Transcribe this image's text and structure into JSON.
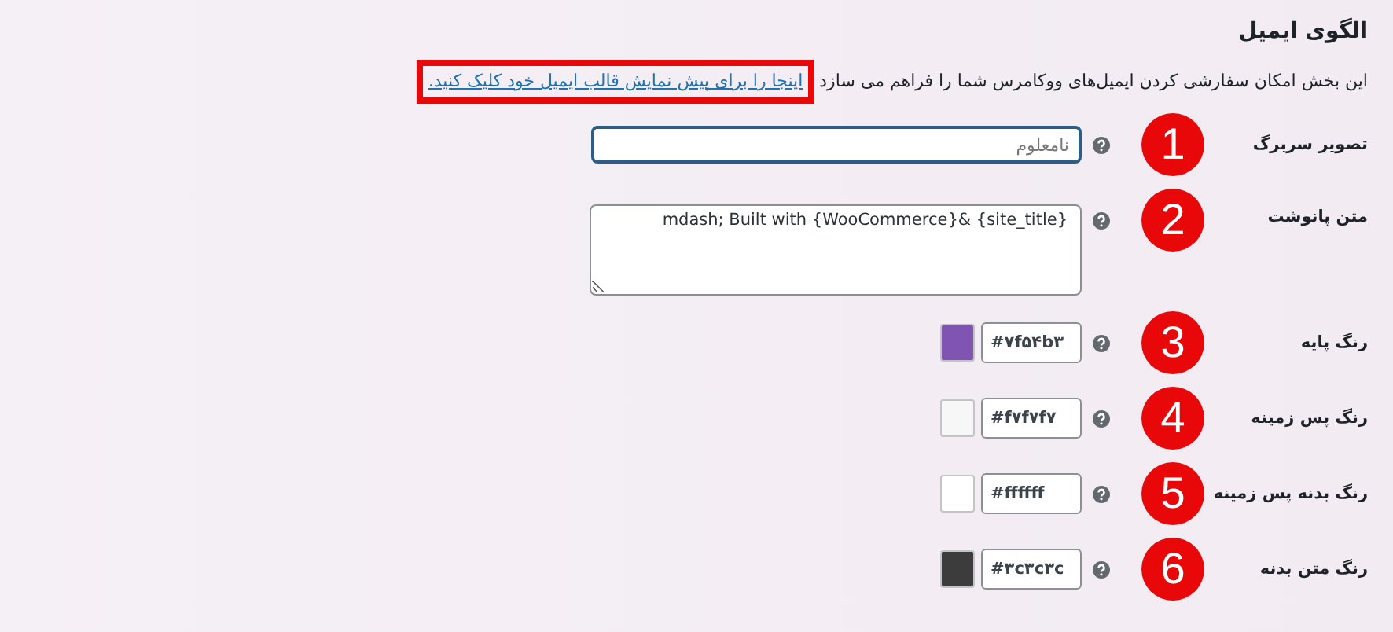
{
  "title": "الگوی ایمیل",
  "description": {
    "text": "این بخش امکان سفارشی کردن ایمیل‌های ووکامرس شما را فراهم می سازد",
    "link": "اینجا را برای پیش نمایش قالب ایمیل خود کلیک کنید.",
    "link_highlighted": true
  },
  "fields": [
    {
      "kind": "text",
      "label": "تصویر سربرگ",
      "badge": "1",
      "placeholder": "نامعلوم",
      "focused": true
    },
    {
      "kind": "textarea",
      "label": "متن پانوشت",
      "badge": "2",
      "value": "mdash; Built with {WooCommerce}& {site_title}"
    },
    {
      "kind": "color",
      "label": "رنگ پایه",
      "badge": "3",
      "value": "#۷f۵۴b۳",
      "color": "#7f54b3"
    },
    {
      "kind": "color",
      "label": "رنگ پس زمینه",
      "badge": "4",
      "value": "#f۷f۷f۷",
      "color": "#f7f7f7"
    },
    {
      "kind": "color",
      "label": "رنگ بدنه پس زمینه",
      "badge": "5",
      "value": "#ffffff",
      "color": "#ffffff"
    },
    {
      "kind": "color",
      "label": "رنگ متن بدنه",
      "badge": "6",
      "value": "#۳c۳c۳c",
      "color": "#3c3c3c"
    }
  ]
}
